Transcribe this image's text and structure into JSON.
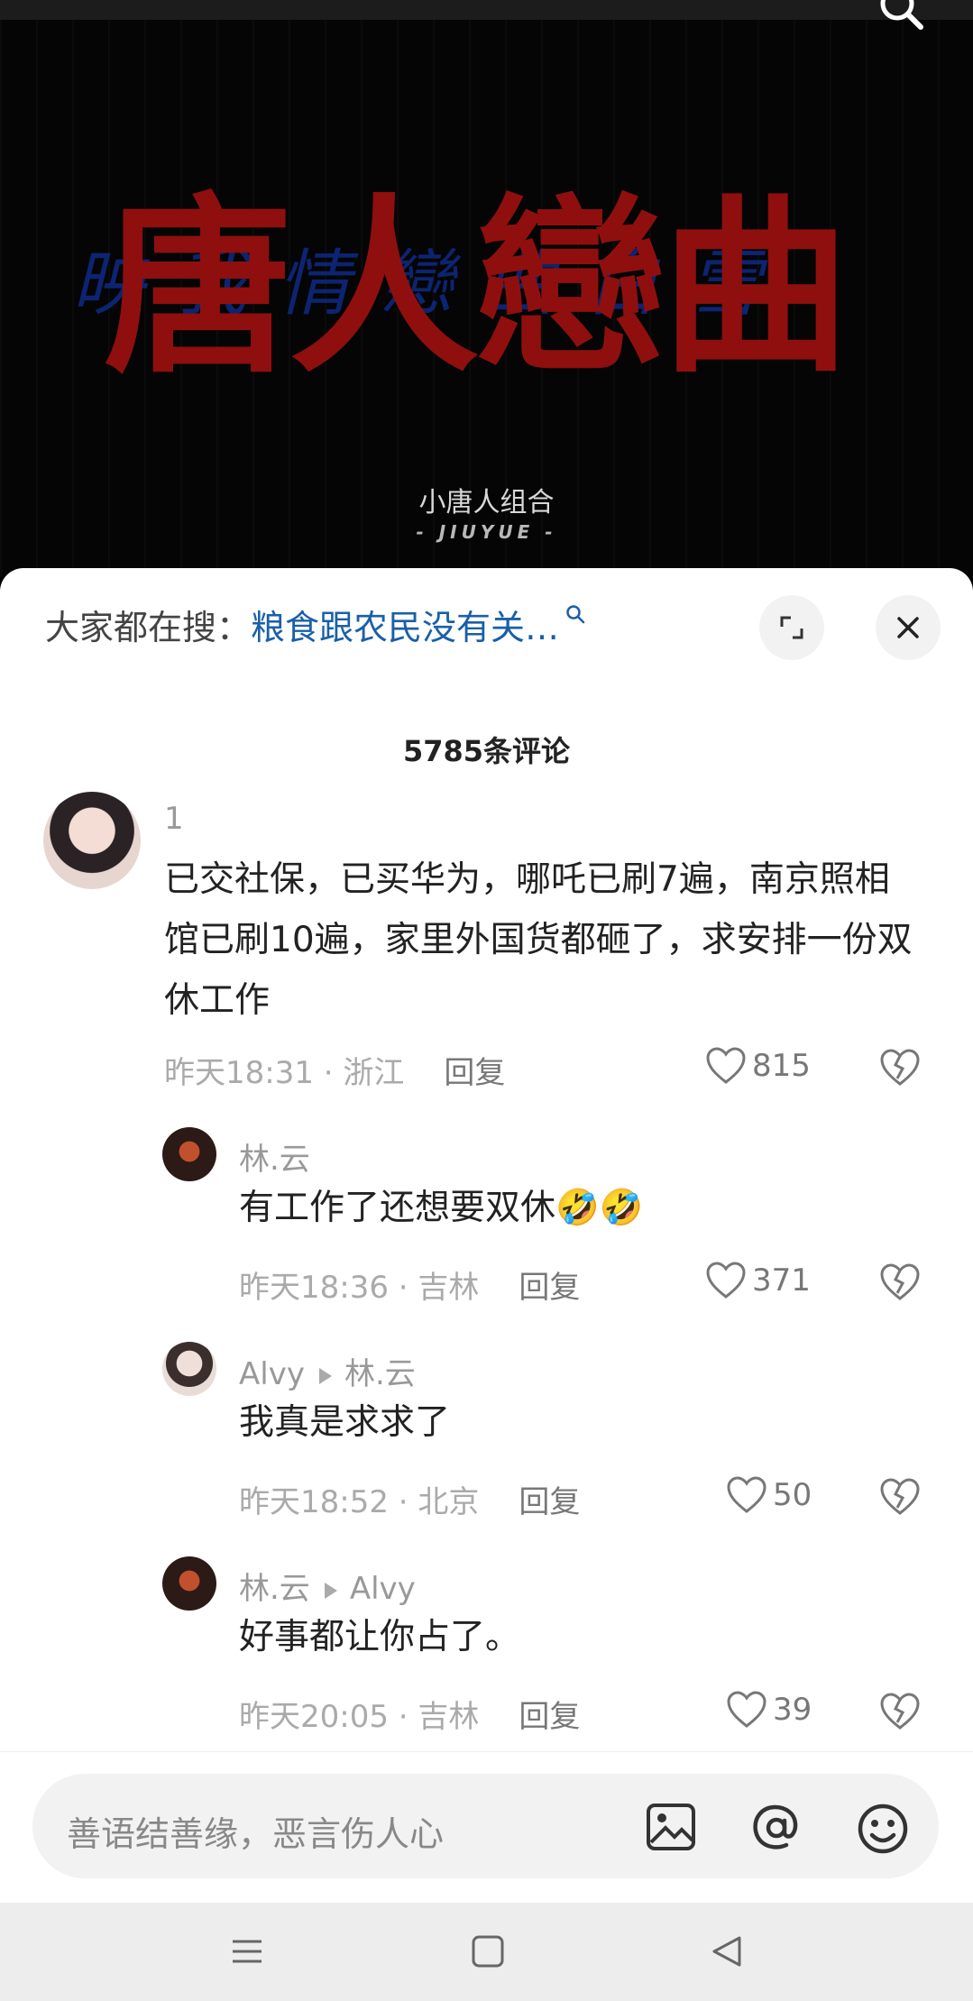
{
  "video": {
    "title_art": "唐人戀曲",
    "title_sub": "映我情戀曲白雪",
    "artist": "小唐人组合",
    "artist_sub": "- JIUYUE -"
  },
  "hot_search": {
    "label": "大家都在搜：",
    "query": "粮食跟农民没有关…"
  },
  "comment_count": "5785条评论",
  "comments": [
    {
      "user": "1",
      "text": "已交社保，已买华为，哪吒已刷7遍，南京照相馆已刷10遍，家里外国货都砸了，求安排一份双休工作",
      "time": "昨天18:31 · 浙江",
      "reply": "回复",
      "likes": "815"
    },
    {
      "user": "林.云",
      "text": "有工作了还想要双休🤣🤣",
      "time": "昨天18:36 · 吉林",
      "reply": "回复",
      "likes": "371"
    },
    {
      "user": "Alvy",
      "reply_to": "林.云",
      "text": "我真是求求了",
      "time": "昨天18:52 · 北京",
      "reply": "回复",
      "likes": "50"
    },
    {
      "user": "林.云",
      "reply_to": "Alvy",
      "text": "好事都让你占了。",
      "time": "昨天20:05 · 吉林",
      "reply": "回复",
      "likes": "39"
    }
  ],
  "input": {
    "placeholder": "善语结善缘，恶言伤人心"
  },
  "icons": {
    "search": "search-icon",
    "expand": "expand-icon",
    "close": "close-icon",
    "like": "heart-icon",
    "dislike": "broken-heart-icon",
    "image": "image-icon",
    "mention": "at-icon",
    "emoji": "emoji-icon",
    "nav_menu": "menu-icon",
    "nav_home": "home-icon",
    "nav_back": "back-icon"
  },
  "colors": {
    "link": "#1a5fa8",
    "title_red": "#8f0f0f",
    "title_blue": "#0e2a86"
  }
}
